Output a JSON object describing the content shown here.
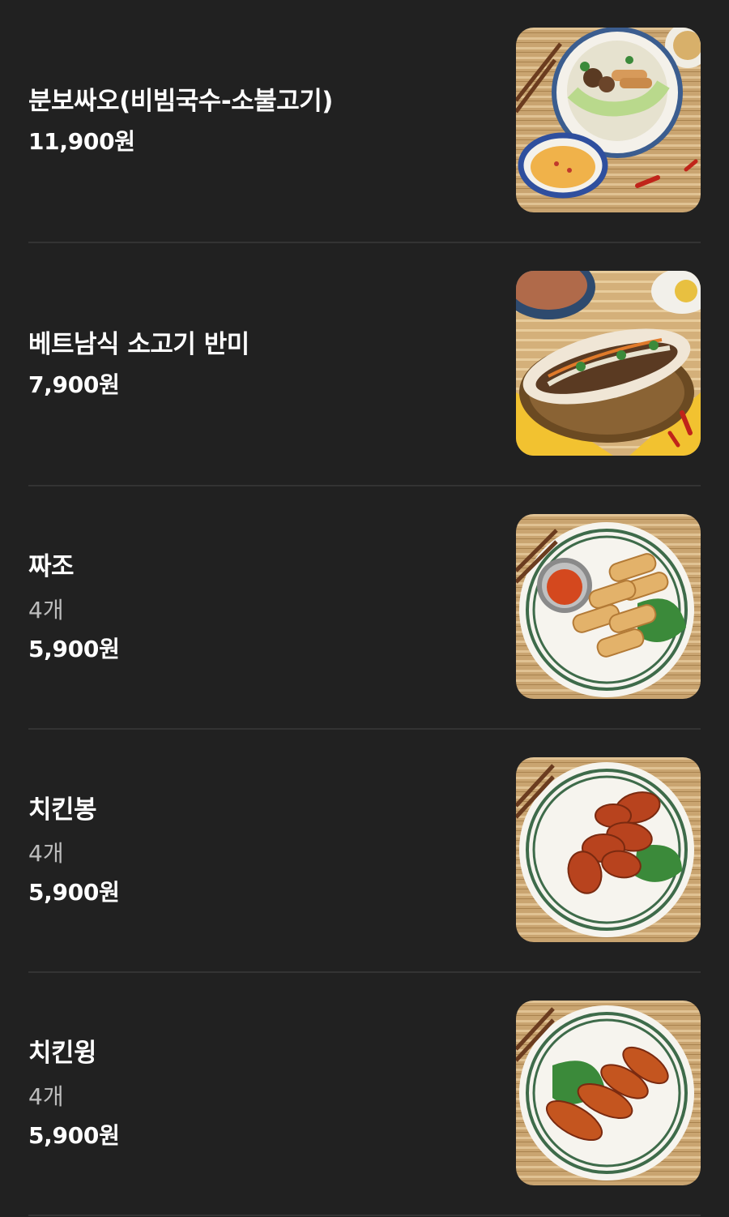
{
  "menu": {
    "items": [
      {
        "name": "분보싸오(비빔국수-소불고기)",
        "desc": "",
        "price": "11,900원",
        "photo_icon": "noodle-bowl-photo"
      },
      {
        "name": "베트남식 소고기 반미",
        "desc": "",
        "price": "7,900원",
        "photo_icon": "banh-mi-photo"
      },
      {
        "name": "짜조",
        "desc": "4개",
        "price": "5,900원",
        "photo_icon": "spring-rolls-photo"
      },
      {
        "name": "치킨봉",
        "desc": "4개",
        "price": "5,900원",
        "photo_icon": "chicken-drumettes-photo"
      },
      {
        "name": "치킨윙",
        "desc": "4개",
        "price": "5,900원",
        "photo_icon": "chicken-wings-photo"
      }
    ]
  },
  "colors": {
    "background": "#212121",
    "divider": "#333333",
    "text_primary": "#ffffff",
    "text_secondary": "#bdbdbd"
  }
}
